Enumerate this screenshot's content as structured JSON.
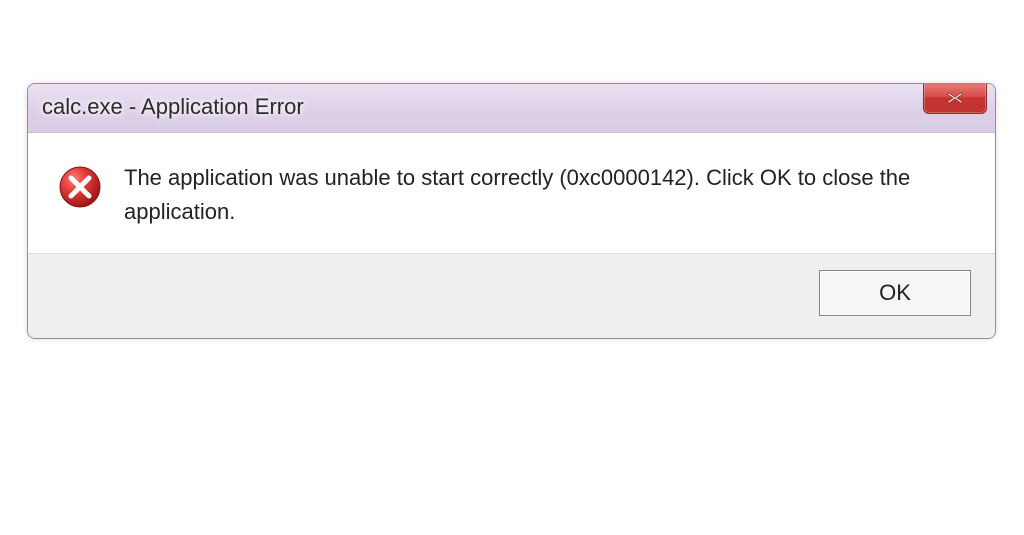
{
  "dialog": {
    "title": "calc.exe - Application Error",
    "message": "The application was unable to start correctly (0xc0000142). Click OK to close the application.",
    "ok_label": "OK",
    "icon": "error-icon",
    "close_icon": "close-icon"
  }
}
